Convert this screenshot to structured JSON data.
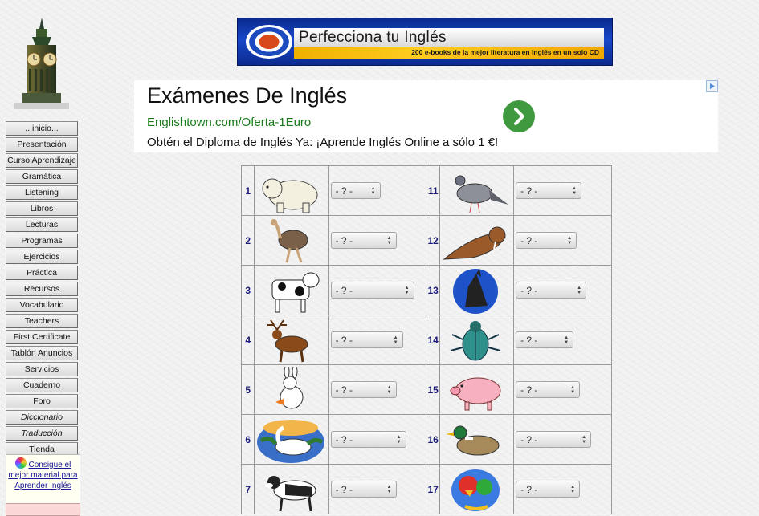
{
  "sidebar": {
    "items": [
      {
        "label": "...inicio...",
        "italic": false
      },
      {
        "label": "Presentación",
        "italic": false
      },
      {
        "label": "Curso Aprendizaje",
        "italic": false
      },
      {
        "label": "Gramática",
        "italic": false
      },
      {
        "label": "Listening",
        "italic": false
      },
      {
        "label": "Libros",
        "italic": false
      },
      {
        "label": "Lecturas",
        "italic": false
      },
      {
        "label": "Programas",
        "italic": false
      },
      {
        "label": "Ejercicios",
        "italic": false
      },
      {
        "label": "Práctica",
        "italic": false
      },
      {
        "label": "Recursos",
        "italic": false
      },
      {
        "label": "Vocabulario",
        "italic": false
      },
      {
        "label": "Teachers",
        "italic": false
      },
      {
        "label": "First Certificate",
        "italic": false
      },
      {
        "label": "Tablón Anuncios",
        "italic": false
      },
      {
        "label": "Servicios",
        "italic": false
      },
      {
        "label": "Cuaderno",
        "italic": false
      },
      {
        "label": "Foro",
        "italic": false
      },
      {
        "label": "Diccionario",
        "italic": true
      },
      {
        "label": "Traducción",
        "italic": true
      },
      {
        "label": "Tienda",
        "italic": false
      }
    ],
    "promo_link": "Consigue el mejor material para Aprender Inglés"
  },
  "banner": {
    "headline": "Perfecciona tu Inglés",
    "subline": "200 e-books de la mejor literatura en Inglés en un solo CD"
  },
  "ad": {
    "title": "Exámenes De Inglés",
    "url": "Englishtown.com/Oferta-1Euro",
    "text": "Obtén el Diploma de Inglés Ya: ¡Aprende Inglés Online a sólo 1 €!"
  },
  "quiz": {
    "rows": [
      {
        "left": {
          "num": "1",
          "animal_icon": "polar-bear-icon",
          "select": "- ? -"
        },
        "right": {
          "num": "11",
          "animal_icon": "pigeon-icon",
          "select": "- ? -"
        }
      },
      {
        "left": {
          "num": "2",
          "animal_icon": "ostrich-icon",
          "select": "- ? -"
        },
        "right": {
          "num": "12",
          "animal_icon": "walrus-icon",
          "select": "- ? -"
        }
      },
      {
        "left": {
          "num": "3",
          "animal_icon": "cow-icon",
          "select": "- ? -"
        },
        "right": {
          "num": "13",
          "animal_icon": "wolf-icon",
          "select": "- ? -"
        }
      },
      {
        "left": {
          "num": "4",
          "animal_icon": "deer-icon",
          "select": "- ? -"
        },
        "right": {
          "num": "14",
          "animal_icon": "beetle-icon",
          "select": "- ? -"
        }
      },
      {
        "left": {
          "num": "5",
          "animal_icon": "rabbit-icon",
          "select": "- ? -"
        },
        "right": {
          "num": "15",
          "animal_icon": "pig-icon",
          "select": "- ? -"
        }
      },
      {
        "left": {
          "num": "6",
          "animal_icon": "swan-icon",
          "select": "- ? -"
        },
        "right": {
          "num": "16",
          "animal_icon": "duck-icon",
          "select": "- ? -"
        }
      },
      {
        "left": {
          "num": "7",
          "animal_icon": "dog-icon",
          "select": "- ? -"
        },
        "right": {
          "num": "17",
          "animal_icon": "parrot-icon",
          "select": "- ? -"
        }
      }
    ]
  }
}
